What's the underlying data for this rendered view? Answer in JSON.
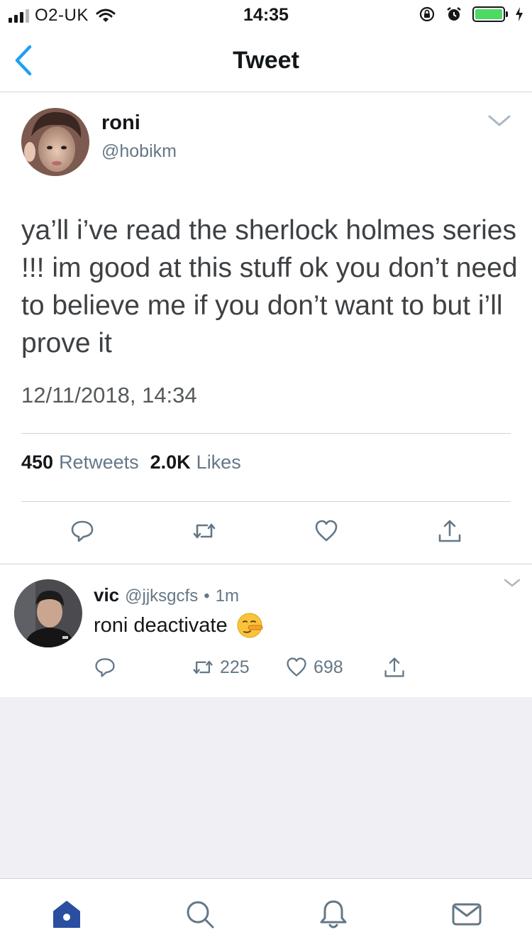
{
  "status_bar": {
    "carrier": "O2-UK",
    "time": "14:35"
  },
  "nav": {
    "title": "Tweet"
  },
  "tweet": {
    "author_name": "roni",
    "author_handle": "@hobikm",
    "text": "ya’ll i’ve read the sherlock holmes series !!! im good at this stuff ok you don’t need to believe me if you don’t want to but i’ll prove it",
    "timestamp": "12/11/2018, 14:34",
    "retweets_count": "450",
    "retweets_label": "Retweets",
    "likes_count": "2.0K",
    "likes_label": "Likes"
  },
  "reply": {
    "author_name": "vic",
    "author_handle": "@jjksgcfs",
    "separator": "•",
    "age": "1m",
    "text": "roni deactivate",
    "retweets_count": "225",
    "likes_count": "698"
  },
  "colors": {
    "accent_blue": "#1da1f2",
    "tab_home_active": "#2a4ea0",
    "secondary_text": "#657786",
    "background_gray": "#efeff4",
    "battery_green": "#4cd964"
  },
  "icons": {
    "reply": "reply-icon",
    "retweet": "retweet-icon",
    "like": "heart-icon",
    "share": "share-icon",
    "home": "home-icon",
    "search": "search-icon",
    "notifications": "bell-icon",
    "messages": "mail-icon"
  }
}
